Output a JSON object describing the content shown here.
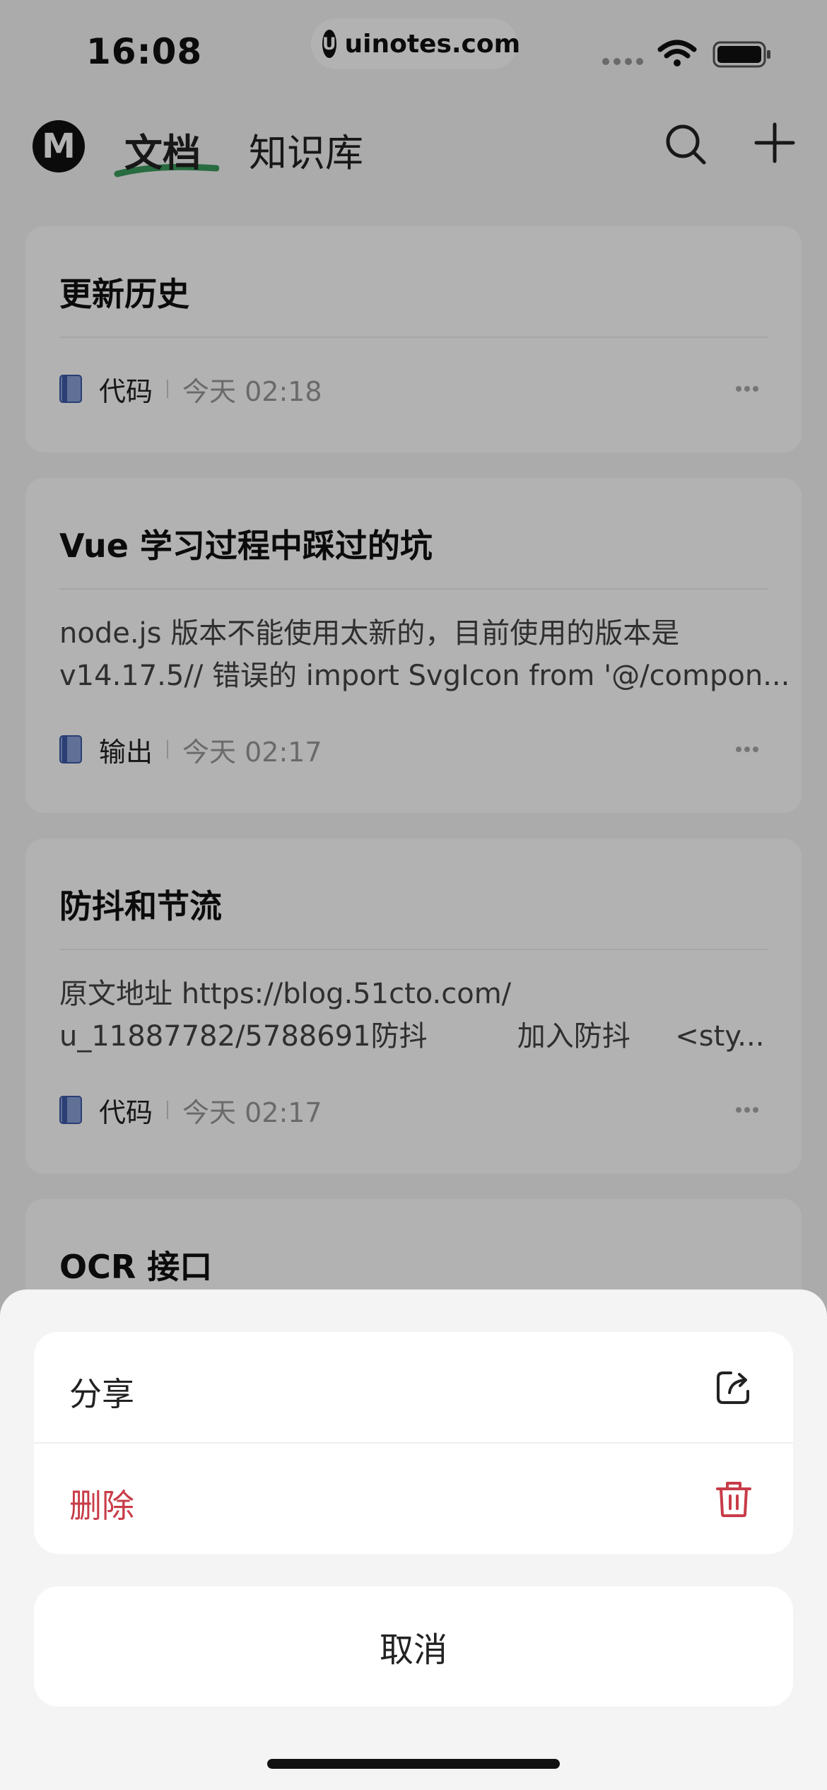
{
  "status_bar": {
    "time": "16:08",
    "site_badge_letter": "U",
    "site_label": "uinotes.com"
  },
  "nav": {
    "logo_letter": "M",
    "tabs": [
      {
        "label": "文档",
        "active": true
      },
      {
        "label": "知识库",
        "active": false
      }
    ],
    "icons": [
      "search-icon",
      "add-icon"
    ],
    "active_underline_color": "#3a9b5c"
  },
  "documents": [
    {
      "title": "更新历史",
      "preview": [],
      "knowledge_base": "代码",
      "time": "今天 02:18"
    },
    {
      "title": "Vue 学习过程中踩过的坑",
      "preview": [
        "node.js 版本不能使用太新的，目前使用的版本是",
        "v14.17.5// 错误的 import SvgIcon from '@/compon..."
      ],
      "knowledge_base": "输出",
      "time": "今天 02:17"
    },
    {
      "title": "防抖和节流",
      "preview": [
        "原文地址 https://blog.51cto.com/",
        "u_11887782/5788691防抖          加入防抖     <sty..."
      ],
      "knowledge_base": "代码",
      "time": "今天 02:17"
    },
    {
      "title": "OCR 接口",
      "preview": [],
      "knowledge_base": "",
      "time": ""
    }
  ],
  "action_sheet": {
    "share_label": "分享",
    "delete_label": "删除",
    "cancel_label": "取消",
    "share_icon": "share-icon",
    "delete_icon": "trash-icon",
    "delete_color": "#c83c48"
  }
}
